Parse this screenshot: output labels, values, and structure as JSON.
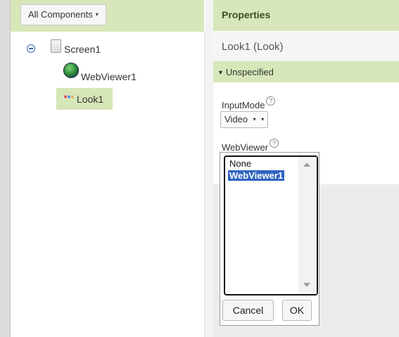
{
  "components": {
    "select_label": "All Components",
    "select_caret": "▾",
    "tree": [
      {
        "label": "Screen1",
        "icon": "screen-icon"
      },
      {
        "label": "WebViewer1",
        "icon": "globe-icon"
      },
      {
        "label": "Look1",
        "icon": "look-icon",
        "selected": true
      }
    ]
  },
  "properties": {
    "title": "Properties",
    "component_name": "Look1 (Look)",
    "section": "Unspecified",
    "section_caret": "▼",
    "input_mode": {
      "label": "InputMode",
      "value": "Video",
      "help": "?"
    },
    "webviewer": {
      "label": "WebViewer",
      "help": "?",
      "options": [
        "None",
        "WebViewer1"
      ],
      "selected": "WebViewer1",
      "cancel_label": "Cancel",
      "ok_label": "OK"
    }
  },
  "colors": {
    "header_green": "#d7e7b9",
    "selection_blue": "#2f64c0"
  }
}
